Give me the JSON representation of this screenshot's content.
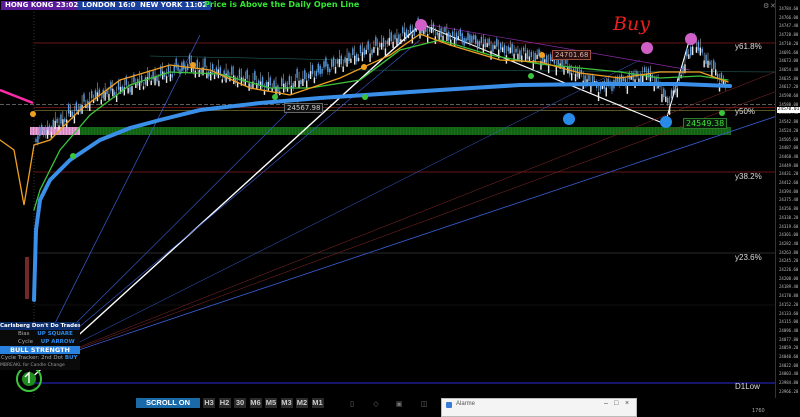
{
  "sessions": {
    "hk_label": "HONG KONG 23:02",
    "london_label": "LONDON 16:02",
    "ny_label": "NEW YORK 11:02",
    "status_text": "Price is Above the Daily Open Line"
  },
  "fib_levels": {
    "f618": "y61.8%",
    "f50": "y50%",
    "f382": "y38.2%",
    "f236": "y23.6%",
    "d1low": "D1Low"
  },
  "annotations": {
    "buy_text": "Buy",
    "price_tag_1": "24701.68",
    "price_tag_2": "24567.98",
    "price_tag_3": "24549.38"
  },
  "price_axis": {
    "ticks": [
      "24784.60",
      "24766.00",
      "24747.40",
      "24728.80",
      "24710.20",
      "24691.60",
      "24673.00",
      "24654.40",
      "24635.80",
      "24617.20",
      "24598.60",
      "24580.00",
      "24561.40",
      "24542.80",
      "24524.20",
      "24505.60",
      "24487.00",
      "24468.40",
      "24449.80",
      "24431.20",
      "24412.60",
      "24394.00",
      "24375.40",
      "24356.80",
      "24338.20",
      "24319.60",
      "24301.00",
      "24282.40",
      "24263.80",
      "24245.20",
      "24226.60",
      "24208.00",
      "24189.40",
      "24170.80",
      "24152.20",
      "24133.60",
      "24115.00",
      "24096.40",
      "24077.80",
      "24059.20",
      "24040.60",
      "24022.00",
      "24003.40",
      "23984.80",
      "23966.20"
    ],
    "current_price": "24570.01"
  },
  "time_axis": {
    "label": "1760"
  },
  "info_panel": {
    "title": "Carlsberg Don't Do Trades",
    "row1_label": "Bias",
    "row1_value": "UP SQUARE",
    "row2_label": "Cycle",
    "row2_value": "UP ARROW",
    "strength": "BULL STRENGTH",
    "row3_label": "Cycle Tracker: 2nd Dot",
    "row3_value": "BUY",
    "row4": "MBREAKL for Candle Change"
  },
  "toolbar": {
    "scroll_label": "SCROLL ON",
    "timeframes": [
      "H3",
      "H2",
      "30",
      "M6",
      "M5",
      "M3",
      "M2",
      "M1"
    ]
  },
  "popup": {
    "title": "Alarme"
  },
  "colors": {
    "ma_blue": "#3a8fe8",
    "ma_orange": "#f0a020",
    "ma_green": "#3cc43c",
    "candle_up": "#5aa0e6",
    "white_line": "#ffffff",
    "hk_bg": "#5a1a9a",
    "london_bg": "#1a3f9c",
    "ny_bg": "#1a3f9c",
    "status_color": "#32e632"
  }
}
